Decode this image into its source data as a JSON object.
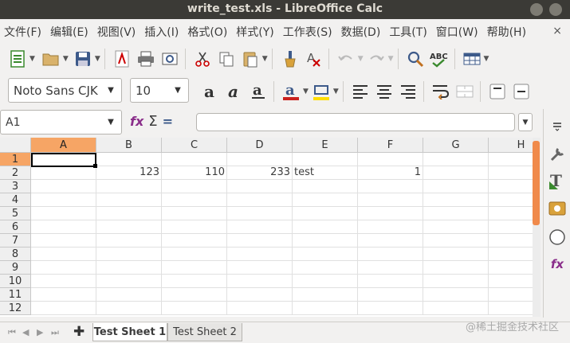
{
  "window": {
    "title": "write_test.xls - LibreOffice Calc"
  },
  "menu": {
    "items": [
      "文件(F)",
      "编辑(E)",
      "视图(V)",
      "插入(I)",
      "格式(O)",
      "样式(Y)",
      "工作表(S)",
      "数据(D)",
      "工具(T)",
      "窗口(W)",
      "帮助(H)"
    ],
    "close_glyph": "×"
  },
  "format_toolbar": {
    "font_name": "Noto Sans CJK",
    "font_size": "10"
  },
  "formula_bar": {
    "name_box": "A1",
    "content": ""
  },
  "grid": {
    "columns": [
      "A",
      "B",
      "C",
      "D",
      "E",
      "F",
      "G",
      "H"
    ],
    "rows": [
      "1",
      "2",
      "3",
      "4",
      "5",
      "6",
      "7",
      "8",
      "9",
      "10",
      "11",
      "12"
    ],
    "active_cell": "A1",
    "cells": {
      "B2": "123",
      "C2": "110",
      "D2": "233",
      "E2": "test",
      "F2": "1"
    }
  },
  "sheets": {
    "tabs": [
      "Test Sheet 1",
      "Test Sheet 2"
    ],
    "active": "Test Sheet 1",
    "add_glyph": "✚"
  },
  "watermark": "@稀土掘金技术社区",
  "colors": {
    "accent": "#f6a565",
    "titlebar": "#3b3a36",
    "scroll_thumb": "#f08a4b"
  }
}
